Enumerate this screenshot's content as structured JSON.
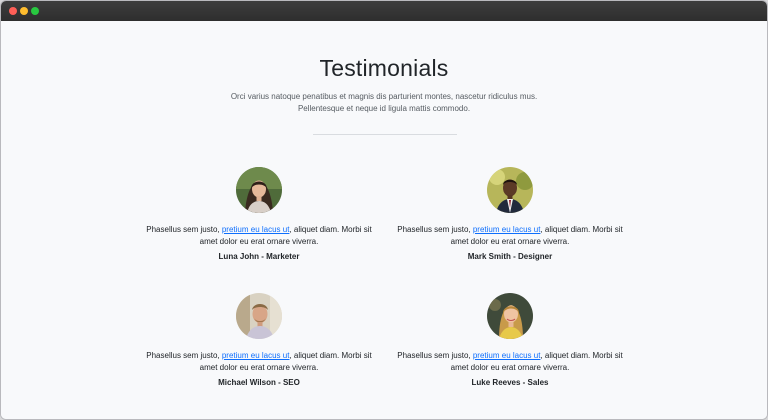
{
  "window": {
    "controls": [
      "close",
      "minimize",
      "zoom"
    ]
  },
  "header": {
    "title": "Testimonials",
    "subtitle_line1": "Orci varius natoque penatibus et magnis dis parturient montes, nascetur ridiculus mus.",
    "subtitle_line2": "Pellentesque et neque id ligula mattis commodo."
  },
  "testimonials": [
    {
      "text_before": "Phasellus sem justo, ",
      "link": "pretium eu lacus ut",
      "text_after": ", aliquet diam. Morbi sit amet dolor eu erat ornare viverra.",
      "author": "Luna John - Marketer"
    },
    {
      "text_before": "Phasellus sem justo, ",
      "link": "pretium eu lacus ut",
      "text_after": ", aliquet diam. Morbi sit amet dolor eu erat ornare viverra.",
      "author": "Mark Smith - Designer"
    },
    {
      "text_before": "Phasellus sem justo, ",
      "link": "pretium eu lacus ut",
      "text_after": ", aliquet diam. Morbi sit amet dolor eu erat ornare viverra.",
      "author": "Michael Wilson - SEO"
    },
    {
      "text_before": "Phasellus sem justo, ",
      "link": "pretium eu lacus ut",
      "text_after": ", aliquet diam. Morbi sit amet dolor eu erat ornare viverra.",
      "author": "Luke Reeves - Sales"
    }
  ],
  "colors": {
    "link": "#0d6efd",
    "text": "#212529",
    "muted": "#555b61",
    "background": "#f8f9fb"
  }
}
